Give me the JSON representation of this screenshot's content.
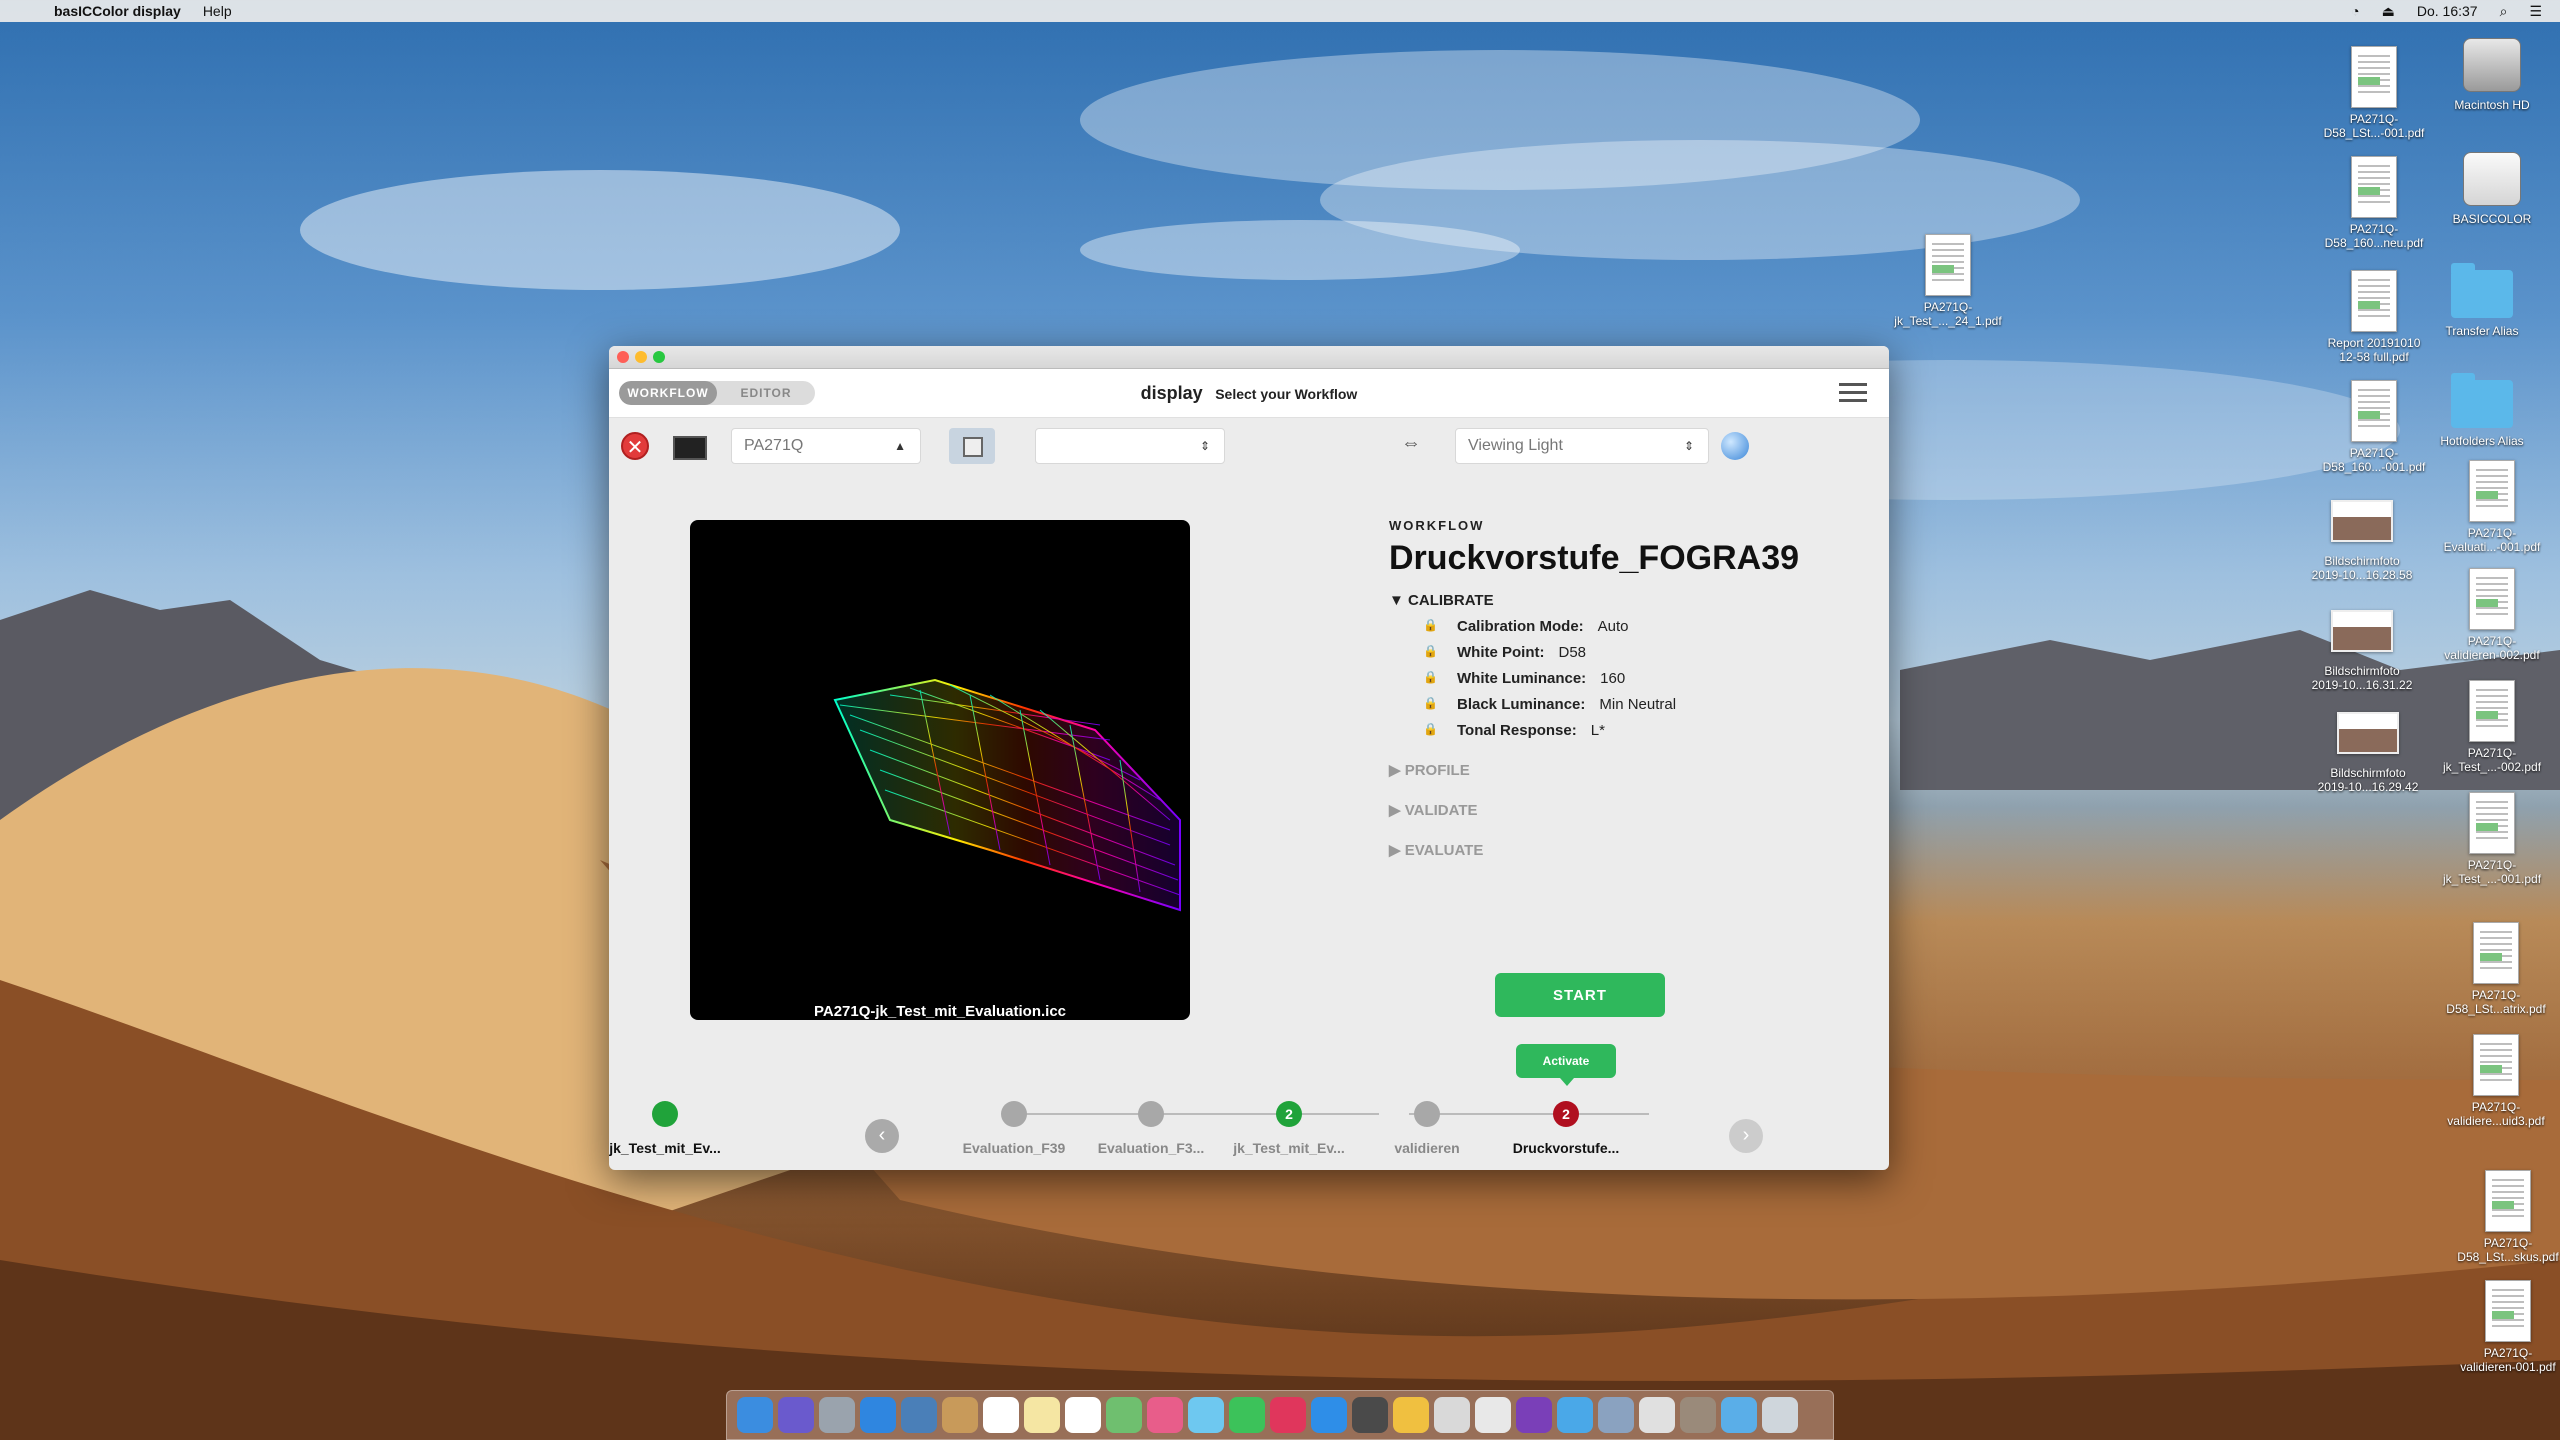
{
  "menubar": {
    "app_name": "basICColor display",
    "menus": [
      "Help"
    ],
    "clock": "Do. 16:37"
  },
  "desktop_icons": [
    {
      "label": "Macintosh HD",
      "type": "disk"
    },
    {
      "label": "BASICCOLOR",
      "type": "disk-white"
    },
    {
      "label": "Transfer Alias",
      "type": "folder"
    },
    {
      "label": "Hotfolders Alias",
      "type": "folder"
    },
    {
      "label": "PA271Q-\nEvaluati...-001.pdf",
      "type": "doc"
    },
    {
      "label": "PA271Q-\nvalidieren-002.pdf",
      "type": "doc"
    },
    {
      "label": "PA271Q-\njk_Test_...-002.pdf",
      "type": "doc"
    },
    {
      "label": "PA271Q-\njk_Test_...-001.pdf",
      "type": "doc"
    },
    {
      "label": "PA271Q-\nD58_LSt...atrix.pdf",
      "type": "doc"
    },
    {
      "label": "PA271Q-\nvalidiere...uid3.pdf",
      "type": "doc"
    },
    {
      "label": "PA271Q-\nD58_LSt...skus.pdf",
      "type": "doc"
    },
    {
      "label": "PA271Q-\nvalidieren-001.pdf",
      "type": "doc"
    },
    {
      "label": "PA271Q-\nD58_LSt...-001.pdf",
      "type": "doc"
    },
    {
      "label": "PA271Q-\nD58_160...neu.pdf",
      "type": "doc"
    },
    {
      "label": "Report 20191010\n12-58 full.pdf",
      "type": "doc"
    },
    {
      "label": "PA271Q-\nD58_160...-001.pdf",
      "type": "doc"
    },
    {
      "label": "Bildschirmfoto\n2019-10...16.28.58",
      "type": "thumb"
    },
    {
      "label": "Bildschirmfoto\n2019-10...16.31.22",
      "type": "thumb"
    },
    {
      "label": "Bildschirmfoto\n2019-10...16.29.42",
      "type": "thumb"
    },
    {
      "label": "PA271Q-\njk_Test_..._24_1.pdf",
      "type": "doc"
    }
  ],
  "window": {
    "tabs": [
      {
        "label": "WORKFLOW",
        "active": true
      },
      {
        "label": "EDITOR",
        "active": false
      }
    ],
    "title_app": "display",
    "title_sub": "Select your Workflow",
    "toolbar": {
      "display_select": "PA271Q",
      "second_select": "",
      "viewing_select": "Viewing Light"
    },
    "preview_caption": "PA271Q-jk_Test_mit_Evaluation.icc",
    "panel": {
      "eyebrow": "WORKFLOW",
      "name": "Druckvorstufe_FOGRA39",
      "calibrate_label": "CALIBRATE",
      "rows": [
        {
          "key": "Calibration Mode:",
          "value": "Auto"
        },
        {
          "key": "White Point:",
          "value": "D58"
        },
        {
          "key": "White Luminance:",
          "value": "160"
        },
        {
          "key": "Black Luminance:",
          "value": "Min Neutral"
        },
        {
          "key": "Tonal Response:",
          "value": "L*"
        }
      ],
      "collapsed_sections": [
        "PROFILE",
        "VALIDATE",
        "EVALUATE"
      ]
    },
    "start_label": "START",
    "activate_label": "Activate",
    "timeline": [
      {
        "label": "jk_Test_mit_Ev...",
        "badge": "",
        "state": "green",
        "bold": true
      },
      {
        "label": "Evaluation_F39",
        "badge": "",
        "state": "gray",
        "bold": false
      },
      {
        "label": "Evaluation_F3...",
        "badge": "",
        "state": "gray",
        "bold": false
      },
      {
        "label": "jk_Test_mit_Ev...",
        "badge": "2",
        "state": "green",
        "bold": false
      },
      {
        "label": "validieren",
        "badge": "",
        "state": "gray",
        "bold": false
      },
      {
        "label": "Druckvorstufe...",
        "badge": "2",
        "state": "red",
        "bold": true
      }
    ]
  },
  "dock_colors": [
    "#3b8de0",
    "#6a5acd",
    "#9aa3ad",
    "#2f86e0",
    "#4a7fb8",
    "#c89a5a",
    "#ffffff",
    "#f5e6a3",
    "#ffffff",
    "#6fbf6f",
    "#e85d8a",
    "#6ec8f0",
    "#3cc25a",
    "#e0365c",
    "#2e8ee8",
    "#4a4a4a",
    "#f0c040",
    "#d9d9d9",
    "#e8e8e8",
    "#7a3fb8",
    "#4aa8e8",
    "#8aa2c0",
    "#e0e0e0",
    "#9a8a7a",
    "#5aaee8",
    "#cfd6dc"
  ]
}
